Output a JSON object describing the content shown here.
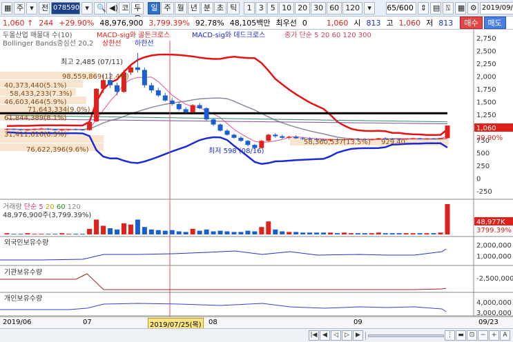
{
  "toolbar": {
    "market": "주",
    "period_mode": "전",
    "code": "078590",
    "exchange": "코",
    "name": "두올산업",
    "periods": [
      "일",
      "주",
      "월",
      "년",
      "분",
      "초",
      "틱"
    ],
    "selected_period": "일",
    "minute_options": [
      "1",
      "3",
      "5",
      "10",
      "20",
      "30",
      "60",
      "120"
    ],
    "count": "65/600",
    "date": "2019/09/23"
  },
  "quote": {
    "price": "1,060",
    "arrow": "↑",
    "change": "244",
    "change_pct": "+29.90%",
    "volume": "48,976,900",
    "vol_ratio": "3,799.39%",
    "ratio2": "92.78%",
    "amount": "48,105백만",
    "priority_label": "최우선",
    "priority_val": "0",
    "ask": "1,060",
    "open_label": "시",
    "open": "813",
    "high_label": "고",
    "high": "1,060",
    "low_label": "저",
    "low": "813",
    "buy": "매수",
    "sell": "매도"
  },
  "legend": {
    "main": "두올산업 매물대 수(10)",
    "macd_golden": "MACD-sig와 골든크로스",
    "macd_dead": "MACD-sig와 데드크로스",
    "ma": "종가 단순 5 20 60 120 300",
    "bollinger": "Bollinger Bands중심선 20,2",
    "upper": "상한선",
    "lower": "하한선"
  },
  "annotations": {
    "high_label": "최고 2,485 (07/11)",
    "low_label": "최저 598 (08/16)",
    "vp1": "98,559,869(12.4%)",
    "vp2": "40,373,440(5.1%)",
    "vp3": "58,433,233(7.3%)",
    "vp4": "46,603,464(5.9%)",
    "vp5": "71,643,334(9.0%)",
    "vp6": "61,844,389(8.1%)",
    "vp7": "76,622,396(9.6%)",
    "vp8": "31,411,616(6.5%)",
    "vp9": "58,360,537(13.5%)",
    "vp10": "929,40"
  },
  "price_axis": [
    "2,750",
    "2,500",
    "2,250",
    "2,000",
    "1,750",
    "1,500",
    "1,250",
    "1,000",
    "750",
    "500",
    "250",
    "0",
    "-250"
  ],
  "price_tag": "1,060",
  "price_tag_pct": "29.90%",
  "volume_legend": {
    "title": "거래량",
    "ma": "단순",
    "ma_values": [
      "5",
      "20",
      "60",
      "120"
    ],
    "text": "48,976,900주(3,799.39%)",
    "tag1": "48,977K",
    "tag2": "3799.39%"
  },
  "foreign": {
    "title": "외국인보유수량",
    "axis": [
      "2,000,000",
      "1,000,000"
    ]
  },
  "inst": {
    "title": "기관보유수량",
    "axis": [
      "-2,500,000"
    ]
  },
  "indiv": {
    "title": "개인보유수량",
    "axis": [
      "4,000,000",
      "3,000,000"
    ]
  },
  "xaxis": {
    "labels": [
      "2019/06",
      "07",
      "08",
      "09"
    ],
    "cursor_date": "2019/07/25(목)",
    "end_date": "09/23"
  },
  "colors": {
    "up": "#e0201a",
    "down": "#1a5fd0",
    "upper": "#e81010",
    "lower": "#1a2ad8",
    "ma300": "#000000"
  },
  "chart_data": {
    "type": "candlestick",
    "candles": [
      [
        980,
        1010,
        960,
        990
      ],
      [
        990,
        1005,
        970,
        985
      ],
      [
        985,
        1000,
        960,
        975
      ],
      [
        975,
        990,
        950,
        980
      ],
      [
        980,
        1000,
        965,
        995
      ],
      [
        995,
        1020,
        980,
        1000
      ],
      [
        1000,
        1010,
        975,
        990
      ],
      [
        990,
        1000,
        960,
        970
      ],
      [
        970,
        985,
        950,
        980
      ],
      [
        980,
        995,
        960,
        985
      ],
      [
        985,
        1000,
        970,
        980
      ],
      [
        980,
        990,
        960,
        970
      ],
      [
        970,
        1140,
        960,
        1130
      ],
      [
        1140,
        1790,
        1130,
        1780
      ],
      [
        1780,
        2060,
        1700,
        1950
      ],
      [
        1950,
        2100,
        1800,
        1850
      ],
      [
        1850,
        1900,
        1650,
        1720
      ],
      [
        1720,
        2150,
        1700,
        2100
      ],
      [
        2100,
        2250,
        2050,
        2200
      ],
      [
        2200,
        2485,
        2100,
        2150
      ],
      [
        2150,
        2200,
        1800,
        1850
      ],
      [
        1850,
        1900,
        1700,
        1750
      ],
      [
        1750,
        1800,
        1620,
        1650
      ],
      [
        1650,
        1700,
        1530,
        1550
      ],
      [
        1550,
        1600,
        1450,
        1480
      ],
      [
        1480,
        1520,
        1350,
        1380
      ],
      [
        1380,
        1420,
        1300,
        1320
      ],
      [
        1320,
        1480,
        1310,
        1460
      ],
      [
        1460,
        1500,
        1380,
        1400
      ],
      [
        1400,
        1420,
        1150,
        1180
      ],
      [
        1180,
        1200,
        1050,
        1080
      ],
      [
        1080,
        1100,
        940,
        960
      ],
      [
        960,
        990,
        860,
        880
      ],
      [
        880,
        900,
        800,
        820
      ],
      [
        820,
        850,
        740,
        760
      ],
      [
        760,
        780,
        650,
        680
      ],
      [
        680,
        700,
        598,
        620
      ],
      [
        620,
        780,
        610,
        760
      ],
      [
        760,
        900,
        740,
        880
      ],
      [
        880,
        910,
        820,
        850
      ],
      [
        850,
        880,
        800,
        820
      ],
      [
        820,
        860,
        790,
        840
      ],
      [
        840,
        870,
        800,
        810
      ],
      [
        810,
        840,
        780,
        800
      ],
      [
        800,
        830,
        770,
        790
      ],
      [
        790,
        820,
        760,
        780
      ],
      [
        780,
        800,
        760,
        770
      ],
      [
        770,
        800,
        750,
        790
      ],
      [
        790,
        810,
        770,
        780
      ],
      [
        780,
        800,
        760,
        790
      ],
      [
        790,
        810,
        770,
        800
      ],
      [
        800,
        820,
        780,
        790
      ],
      [
        790,
        810,
        775,
        785
      ],
      [
        785,
        800,
        770,
        790
      ],
      [
        790,
        820,
        780,
        810
      ],
      [
        810,
        830,
        790,
        800
      ],
      [
        800,
        815,
        785,
        795
      ],
      [
        795,
        810,
        780,
        790
      ],
      [
        790,
        805,
        780,
        800
      ],
      [
        800,
        820,
        790,
        810
      ],
      [
        810,
        820,
        790,
        800
      ],
      [
        800,
        815,
        790,
        805
      ],
      [
        805,
        815,
        795,
        800
      ],
      [
        800,
        820,
        790,
        816
      ],
      [
        813,
        1060,
        813,
        1060
      ]
    ],
    "ylim": [
      -250,
      2750
    ],
    "volume": [
      2,
      1,
      1,
      2,
      1,
      1,
      1,
      1,
      2,
      1,
      1,
      1,
      9,
      24,
      14,
      10,
      8,
      18,
      16,
      24,
      12,
      8,
      7,
      6,
      7,
      5,
      4,
      9,
      6,
      8,
      5,
      6,
      5,
      4,
      4,
      6,
      5,
      12,
      21,
      8,
      5,
      4,
      4,
      3,
      3,
      3,
      3,
      3,
      2,
      3,
      2,
      2,
      2,
      2,
      3,
      2,
      2,
      2,
      2,
      2,
      2,
      2,
      2,
      3,
      49
    ],
    "volume_unit": "M"
  }
}
